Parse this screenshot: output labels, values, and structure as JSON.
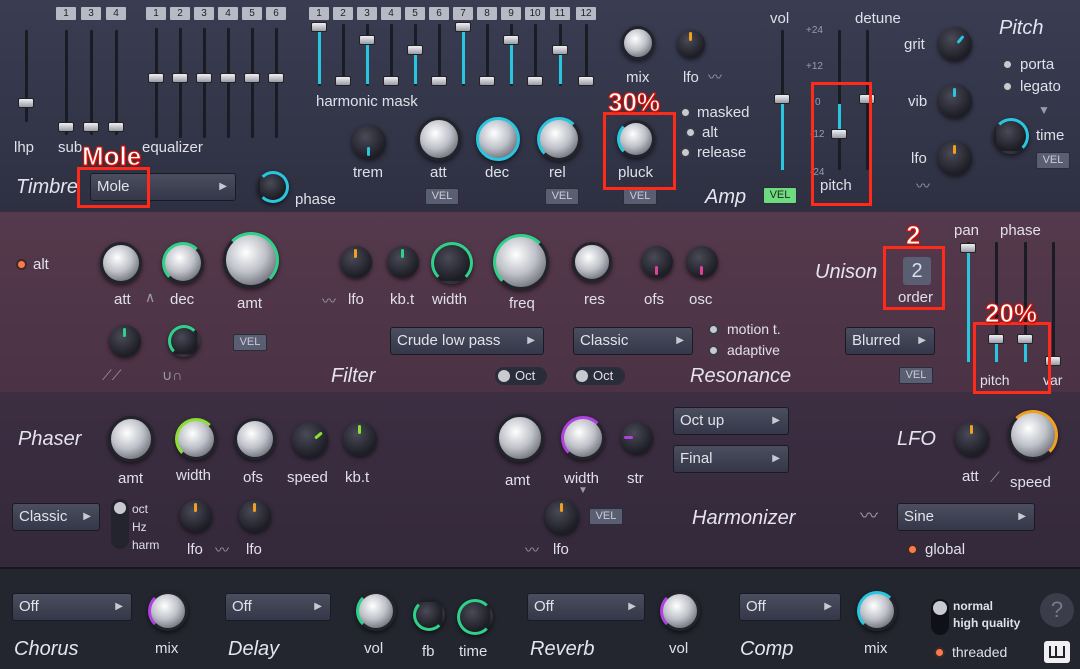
{
  "timbre": {
    "title": "Timbre",
    "preset": "Mole",
    "phase_label": "phase",
    "lhp_label": "lhp",
    "sub_label": "sub",
    "equalizer_label": "equalizer",
    "sub_nums": [
      "1",
      "3",
      "4"
    ],
    "eq_nums": [
      "1",
      "2",
      "3",
      "4",
      "5",
      "6"
    ]
  },
  "harmonic": {
    "label": "harmonic mask",
    "nums": [
      "1",
      "2",
      "3",
      "4",
      "5",
      "6",
      "7",
      "8",
      "9",
      "10",
      "11",
      "12"
    ]
  },
  "amp": {
    "title": "Amp",
    "mix": "mix",
    "lfo": "lfo",
    "trem": "trem",
    "att": "att",
    "dec": "dec",
    "rel": "rel",
    "pluck": "pluck",
    "vel": "VEL",
    "options": [
      "masked",
      "alt",
      "release"
    ],
    "vol": "vol",
    "detune": "detune",
    "pitch": "pitch",
    "scale": [
      "+24",
      "+12",
      "0",
      "-12",
      "-24"
    ]
  },
  "pitch_panel": {
    "title": "Pitch",
    "grit": "grit",
    "vib": "vib",
    "lfo": "lfo",
    "porta": "porta",
    "legato": "legato",
    "time": "time",
    "vel": "VEL"
  },
  "filter": {
    "title": "Filter",
    "alt": "alt",
    "att": "att",
    "dec": "dec",
    "amt": "amt",
    "lfo": "lfo",
    "kbt": "kb.t",
    "width": "width",
    "freq": "freq",
    "res": "res",
    "ofs": "ofs",
    "osc": "osc",
    "type": "Crude low pass",
    "oct": "Oct",
    "vel": "VEL"
  },
  "resonance": {
    "title": "Resonance",
    "type": "Classic",
    "oct": "Oct",
    "motion": "motion t.",
    "adaptive": "adaptive"
  },
  "unison": {
    "title": "Unison",
    "type": "Blurred",
    "vel": "VEL",
    "order_value": "2",
    "order": "order",
    "pan": "pan",
    "phase": "phase",
    "pitch": "pitch",
    "var": "var"
  },
  "phaser": {
    "title": "Phaser",
    "amt": "amt",
    "width": "width",
    "ofs": "ofs",
    "speed": "speed",
    "kbt": "kb.t",
    "type": "Classic",
    "units": [
      "oct",
      "Hz",
      "harm"
    ],
    "lfo1": "lfo",
    "lfo2": "lfo"
  },
  "harmonizer": {
    "title": "Harmonizer",
    "amt": "amt",
    "width": "width",
    "str": "str",
    "lfo": "lfo",
    "vel": "VEL",
    "mode1": "Oct up",
    "mode2": "Final"
  },
  "lfo": {
    "title": "LFO",
    "att": "att",
    "speed": "speed",
    "shape": "Sine",
    "global": "global"
  },
  "fx": {
    "chorus": "Chorus",
    "chorus_val": "Off",
    "chorus_mix": "mix",
    "delay": "Delay",
    "delay_val": "Off",
    "delay_vol": "vol",
    "delay_fb": "fb",
    "delay_time": "time",
    "reverb": "Reverb",
    "reverb_val": "Off",
    "reverb_vol": "vol",
    "comp": "Comp",
    "comp_val": "Off",
    "comp_mix": "mix",
    "quality1": "normal",
    "quality2": "high quality",
    "threaded": "threaded",
    "help": "?"
  },
  "annotations": {
    "mole": "Mole",
    "pluck": "30%",
    "order": "2",
    "pitch": "20%"
  },
  "colors": {
    "accent_cyan": "#29c6e0",
    "accent_green": "#2fd18a",
    "accent_purple": "#b040e0",
    "accent_orange": "#f0a020",
    "annotation_red": "#ff2a1a"
  }
}
